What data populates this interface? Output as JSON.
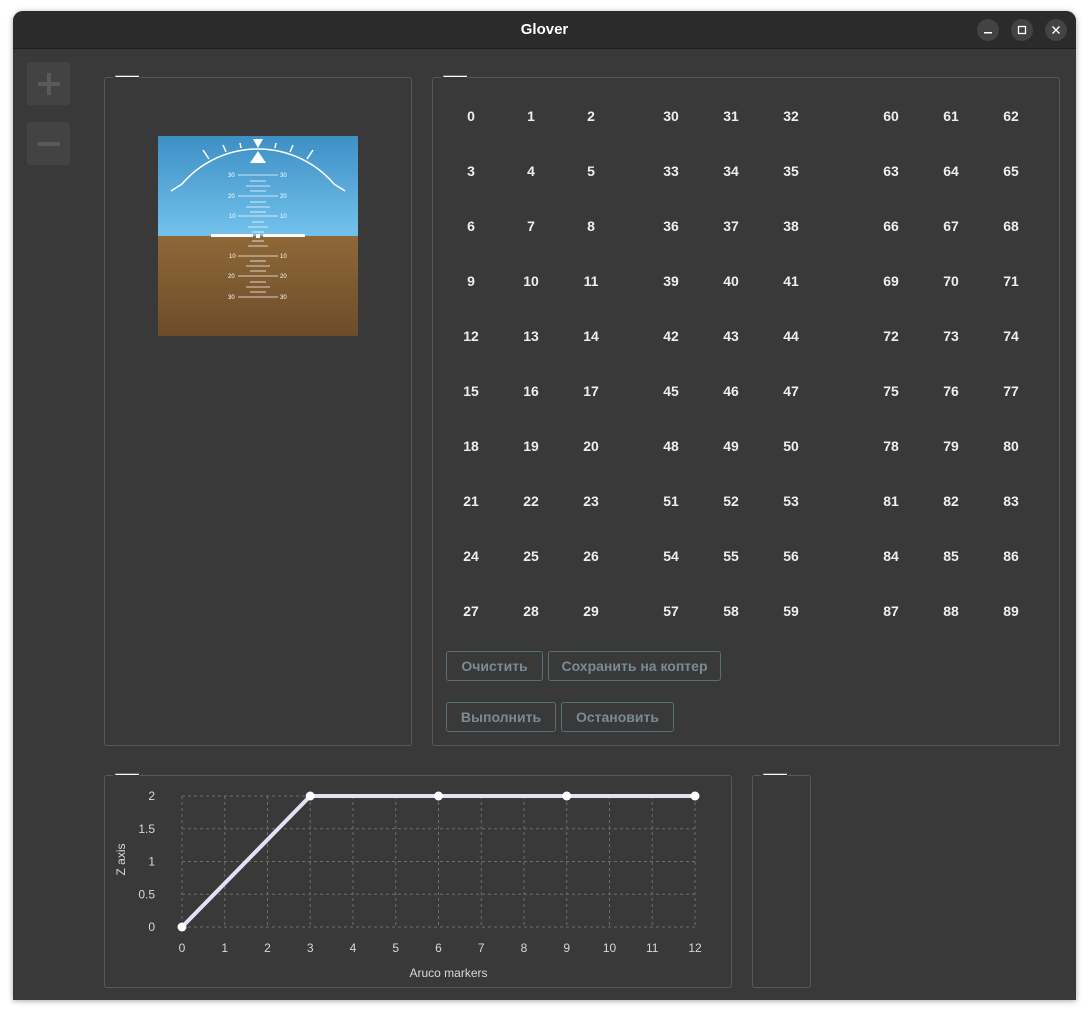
{
  "window": {
    "title": "Glover"
  },
  "titlebar": {
    "minimize_icon": "minimize-icon",
    "maximize_icon": "maximize-icon",
    "close_icon": "close-icon"
  },
  "zoom": {
    "in_icon": "plus-icon",
    "out_icon": "minus-icon"
  },
  "left_panel": {
    "title": "----------"
  },
  "horizon": {
    "pitch_labels_up": [
      "30",
      "20",
      "10"
    ],
    "pitch_labels_down": [
      "10",
      "20",
      "30"
    ],
    "colors": {
      "sky_top": "#3d8fc5",
      "sky_bottom": "#73c2ec",
      "ground_top": "#8f6838",
      "ground_bottom": "#6c4c2a"
    }
  },
  "markers_panel": {
    "title": "----------",
    "groups": [
      [
        "0",
        "1",
        "2",
        "3",
        "4",
        "5",
        "6",
        "7",
        "8",
        "9",
        "10",
        "11",
        "12",
        "13",
        "14",
        "15",
        "16",
        "17",
        "18",
        "19",
        "20",
        "21",
        "22",
        "23",
        "24",
        "25",
        "26",
        "27",
        "28",
        "29"
      ],
      [
        "30",
        "31",
        "32",
        "33",
        "34",
        "35",
        "36",
        "37",
        "38",
        "39",
        "40",
        "41",
        "42",
        "43",
        "44",
        "45",
        "46",
        "47",
        "48",
        "49",
        "50",
        "51",
        "52",
        "53",
        "54",
        "55",
        "56",
        "57",
        "58",
        "59"
      ],
      [
        "60",
        "61",
        "62",
        "63",
        "64",
        "65",
        "66",
        "67",
        "68",
        "69",
        "70",
        "71",
        "72",
        "73",
        "74",
        "75",
        "76",
        "77",
        "78",
        "79",
        "80",
        "81",
        "82",
        "83",
        "84",
        "85",
        "86",
        "87",
        "88",
        "89"
      ]
    ],
    "buttons": {
      "clear": "Очистить",
      "save": "Сохранить на коптер",
      "run": "Выполнить",
      "stop": "Остановить"
    }
  },
  "chart_panel": {
    "title": "----------"
  },
  "chart_data": {
    "type": "line",
    "title": "",
    "xlabel": "Aruco markers",
    "ylabel": "Z axis",
    "xlim": [
      0,
      12
    ],
    "ylim": [
      0,
      2
    ],
    "x_ticks": [
      "0",
      "1",
      "2",
      "3",
      "4",
      "5",
      "6",
      "7",
      "8",
      "9",
      "10",
      "11",
      "12"
    ],
    "y_ticks": [
      "0",
      "0.5",
      "1",
      "1.5",
      "2"
    ],
    "grid": true,
    "series": [
      {
        "x": [
          0,
          3,
          6,
          9,
          12
        ],
        "y": [
          0,
          2,
          2,
          2,
          2
        ]
      }
    ],
    "line_color": "#e6e0f4"
  },
  "side_panel": {
    "title": "----------"
  }
}
